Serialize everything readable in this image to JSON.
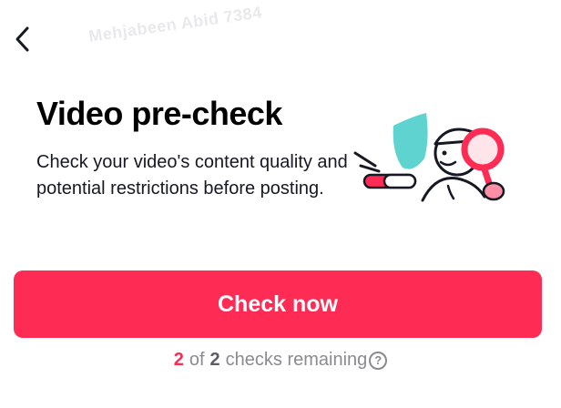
{
  "nav": {
    "back_icon": "chevron-left-icon"
  },
  "watermark": "Mehjabeen Abid 7384",
  "precheck": {
    "title": "Video pre-check",
    "description": "Check your video's content quality and potential restrictions before posting.",
    "illustration_icon": "inspector-with-magnifier-illustration"
  },
  "action": {
    "button_label": "Check now"
  },
  "remaining": {
    "used": "2",
    "of": "of",
    "total": "2",
    "suffix": "checks remaining",
    "help_icon": "question-circle-icon"
  },
  "colors": {
    "accent": "#fe2c55",
    "shield": "#5fd3d0",
    "text": "#161823",
    "muted": "#8a8b91"
  }
}
